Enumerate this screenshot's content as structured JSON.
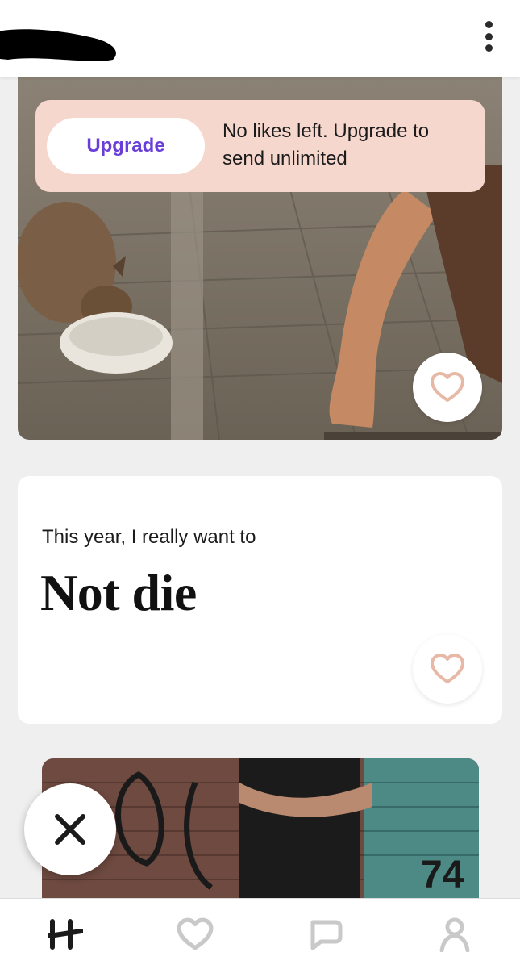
{
  "topbar": {
    "menu_icon": "more-vertical-icon"
  },
  "upsell": {
    "button_label": "Upgrade",
    "message": "No likes left. Upgrade to send unlimited"
  },
  "prompt": {
    "question": "This year, I really want to",
    "answer": "Not die"
  },
  "icons": {
    "like": "heart-outline-icon",
    "pass": "close-x-icon"
  },
  "bottom_nav": [
    {
      "id": "home",
      "icon": "hinge-logo-icon",
      "active": true
    },
    {
      "id": "likes",
      "icon": "heart-icon",
      "active": false
    },
    {
      "id": "matches",
      "icon": "chat-bubble-icon",
      "active": false
    },
    {
      "id": "profile",
      "icon": "person-icon",
      "active": false
    }
  ],
  "colors": {
    "accent_purple": "#6a3fd9",
    "upsell_bg": "#f6d7cd",
    "like_heart": "#e8b8a6",
    "nav_active": "#1b1b1b",
    "nav_inactive": "#c9c9c9"
  }
}
